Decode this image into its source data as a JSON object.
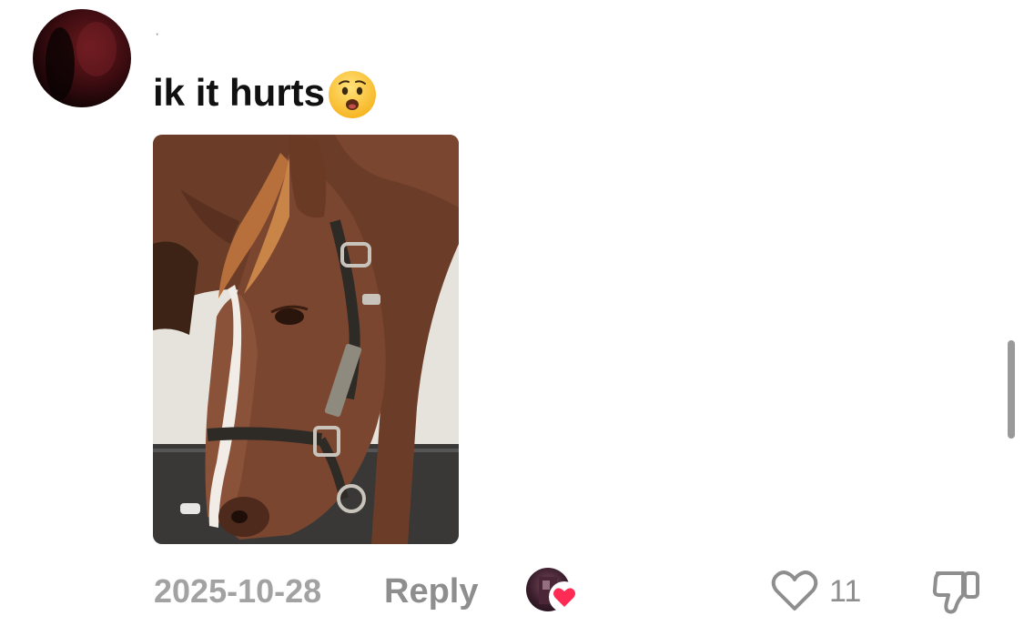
{
  "comment": {
    "username": "·",
    "text": "ik it hurts",
    "emoji_icon": "worried-face-emoji",
    "image_icon": "horse-photo",
    "date": "2025-10-28",
    "reply_label": "Reply",
    "creator_liked_icon": "creator-avatar-heart",
    "like_icon": "heart-outline-icon",
    "like_count": "11",
    "dislike_icon": "thumbs-down-outline-icon"
  },
  "colors": {
    "background": "#ffffff",
    "text": "#111111",
    "muted": "#8e8e8e",
    "heart": "#fe2c55",
    "emoji": "#ffcc3c"
  }
}
